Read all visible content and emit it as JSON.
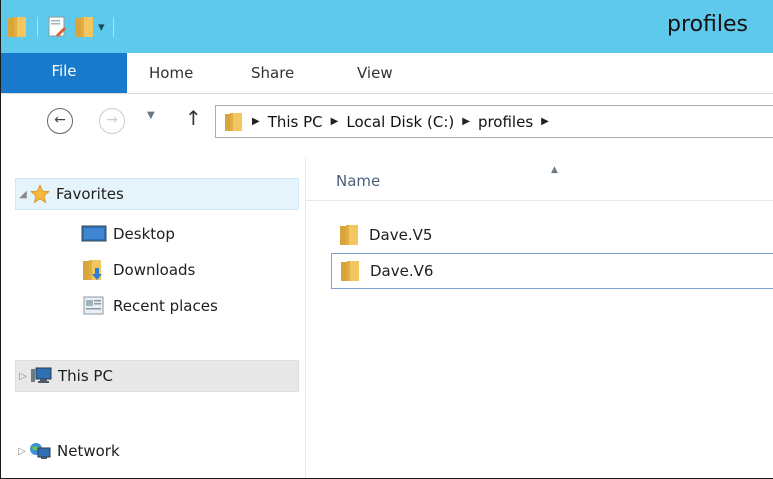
{
  "window": {
    "title": "profiles"
  },
  "quick_access": {
    "icons": [
      "folder-icon",
      "properties-icon",
      "new-folder-icon",
      "customize-arrow-icon"
    ]
  },
  "ribbon": {
    "tabs": [
      {
        "label": "File"
      },
      {
        "label": "Home"
      },
      {
        "label": "Share"
      },
      {
        "label": "View"
      }
    ]
  },
  "address_bar": {
    "breadcrumbs": [
      "This PC",
      "Local Disk (C:)",
      "profiles"
    ]
  },
  "nav_pane": {
    "favorites": {
      "label": "Favorites",
      "items": [
        {
          "label": "Desktop",
          "icon": "desktop-icon"
        },
        {
          "label": "Downloads",
          "icon": "downloads-icon"
        },
        {
          "label": "Recent places",
          "icon": "recent-places-icon"
        }
      ]
    },
    "this_pc": {
      "label": "This PC"
    },
    "network": {
      "label": "Network"
    }
  },
  "content": {
    "column_header": "Name",
    "sorted": "ascending",
    "files": [
      {
        "name": "Dave.V5",
        "icon": "folder-icon"
      },
      {
        "name": "Dave.V6",
        "icon": "folder-icon",
        "focused": true
      }
    ]
  },
  "colors": {
    "titlebar": "#5ec9ea",
    "file_tab": "#1979ca",
    "selection": "#e5f3fb"
  }
}
